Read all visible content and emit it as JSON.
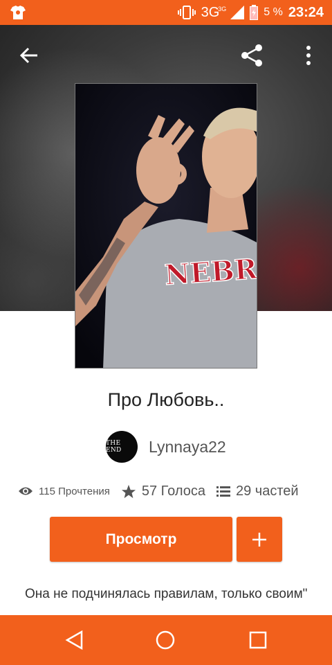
{
  "status_bar": {
    "network": "3G",
    "network_sup": "3G",
    "battery": "5 %",
    "time": "23:24"
  },
  "header": {
    "back_icon": "arrow-left-icon",
    "share_icon": "share-icon",
    "more_icon": "more-vert-icon"
  },
  "story": {
    "title": "Про Любовь..",
    "author": {
      "name": "Lynnaya22",
      "avatar_text": "THE END"
    },
    "cover_shirt_text": "NEBRAS",
    "stats": {
      "reads": "115 Прочтения",
      "votes": "57 Голоса",
      "parts": "29 частей"
    },
    "read_button": "Просмотр",
    "add_button_icon": "plus-icon",
    "description": "Она не подчинялась правилам, только своим\""
  },
  "colors": {
    "accent": "#f2601c"
  },
  "nav": {
    "back": "nav-back-icon",
    "home": "nav-home-icon",
    "recent": "nav-recent-icon"
  }
}
